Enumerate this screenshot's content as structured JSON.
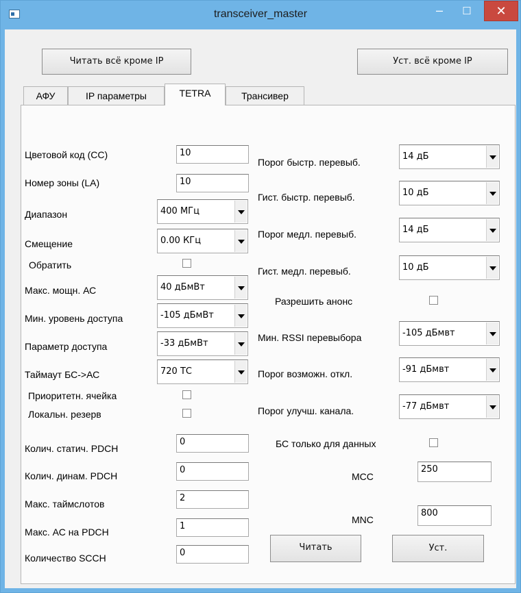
{
  "window": {
    "title": "transceiver_master"
  },
  "toolbar": {
    "read_all": "Читать всё кроме IP",
    "set_all": "Уст. всё кроме IP"
  },
  "tabs": [
    {
      "label": "АФУ",
      "active": false
    },
    {
      "label": "IP параметры",
      "active": false
    },
    {
      "label": "TETRA",
      "active": true
    },
    {
      "label": "Трансивер",
      "active": false
    }
  ],
  "left": {
    "color_code": {
      "label": "Цветовой код (CC)",
      "value": "10"
    },
    "zone_number": {
      "label": "Номер зоны (LA)",
      "value": "10"
    },
    "band": {
      "label": "Диапазон",
      "value": "400 МГц"
    },
    "offset": {
      "label": "Смещение",
      "value": "0.00 КГц"
    },
    "invert": {
      "label": "Обратить",
      "checked": false
    },
    "max_power": {
      "label": "Макс. мощн. АС",
      "value": "40 дБмВт"
    },
    "min_access": {
      "label": "Мин. уровень доступа",
      "value": "-105 дБмВт"
    },
    "access_param": {
      "label": "Параметр доступа",
      "value": "-33 дБмВт"
    },
    "timeout": {
      "label": "Таймаут БС->АС",
      "value": "720 ТС"
    },
    "priority_cell": {
      "label": "Приоритетн. ячейка",
      "checked": false
    },
    "local_reserve": {
      "label": "Локальн. резерв",
      "checked": false
    },
    "static_pdch": {
      "label": "Колич. статич. PDCH",
      "value": "0"
    },
    "dynamic_pdch": {
      "label": "Колич. динам. PDCH",
      "value": "0"
    },
    "max_timeslots": {
      "label": "Макс. таймслотов",
      "value": "2"
    },
    "max_ac_pdch": {
      "label": "Макс. АС на PDCH",
      "value": "1"
    },
    "scch_count": {
      "label": "Количество SCCH",
      "value": "0"
    }
  },
  "right": {
    "fast_threshold": {
      "label": "Порог быстр. перевыб.",
      "value": "14 дБ"
    },
    "fast_hyst": {
      "label": "Гист. быстр. перевыб.",
      "value": "10 дБ"
    },
    "slow_threshold": {
      "label": "Порог медл. перевыб.",
      "value": "14 дБ"
    },
    "slow_hyst": {
      "label": "Гист. медл. перевыб.",
      "value": "10 дБ"
    },
    "allow_announce": {
      "label": "Разрешить анонс",
      "checked": false
    },
    "min_rssi": {
      "label": "Мин. RSSI перевыбора",
      "value": "-105 дБмвт"
    },
    "disconnect_threshold": {
      "label": "Порог возможн. откл.",
      "value": "-91 дБмвт"
    },
    "improve_threshold": {
      "label": "Порог улучш. канала.",
      "value": "-77 дБмвт"
    },
    "data_only": {
      "label": "БС только для данных",
      "checked": false
    },
    "mcc": {
      "label": "MCC",
      "value": "250"
    },
    "mnc": {
      "label": "MNC",
      "value": "800"
    },
    "read_button": "Читать",
    "set_button": "Уст."
  }
}
